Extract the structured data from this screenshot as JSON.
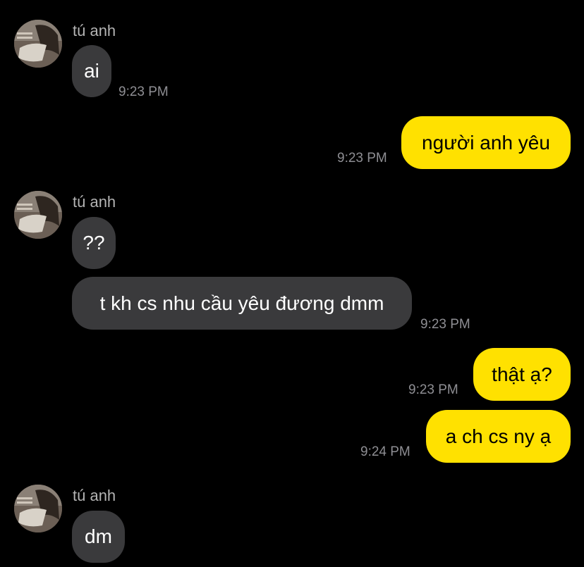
{
  "colors": {
    "background": "#000000",
    "incoming_bubble": "#3a3a3c",
    "outgoing_bubble": "#ffe100",
    "timestamp": "#8e8e93",
    "sender_name": "#b3b3b3"
  },
  "messages": [
    {
      "side": "incoming",
      "sender": "tú anh",
      "text": "ai",
      "time": "9:23 PM"
    },
    {
      "side": "outgoing",
      "text": "người anh yêu",
      "time": "9:23 PM"
    },
    {
      "side": "incoming",
      "sender": "tú anh",
      "text": "??"
    },
    {
      "side": "incoming",
      "text": "t kh cs nhu cầu yêu đương dmm",
      "time": "9:23 PM"
    },
    {
      "side": "outgoing",
      "text": "thật ạ?",
      "time": "9:23 PM"
    },
    {
      "side": "outgoing",
      "text": "a ch cs ny ạ",
      "time": "9:24 PM"
    },
    {
      "side": "incoming",
      "sender": "tú anh",
      "text": "dm"
    }
  ]
}
